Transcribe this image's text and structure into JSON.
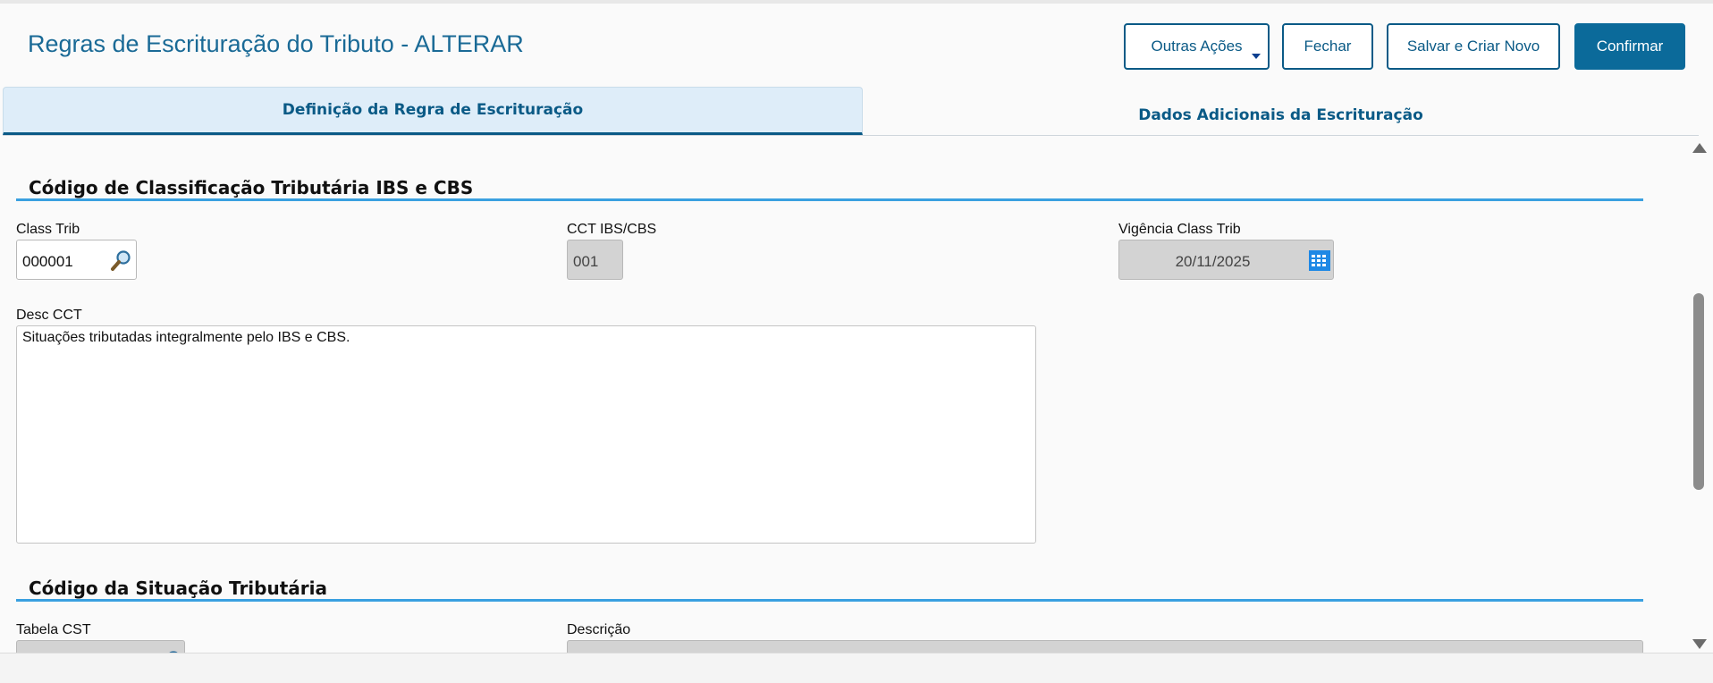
{
  "header": {
    "title": "Regras de Escrituração do Tributo - ALTERAR",
    "buttons": {
      "outras_acoes": "Outras Ações",
      "fechar": "Fechar",
      "salvar_criar_novo": "Salvar e Criar Novo",
      "confirmar": "Confirmar"
    }
  },
  "tabs": [
    {
      "label": "Definição da Regra de Escrituração",
      "active": true
    },
    {
      "label": "Dados Adicionais da Escrituração",
      "active": false
    }
  ],
  "sections": {
    "class_trib": {
      "title": "Código de Classificação Tributária IBS e CBS",
      "class_trib_label": "Class Trib",
      "class_trib_value": "000001",
      "cct_label": "CCT IBS/CBS",
      "cct_value": "001",
      "vigencia_label": "Vigência Class Trib",
      "vigencia_value": "20/11/2025",
      "desc_label": "Desc CCT",
      "desc_value": "Situações tributadas integralmente pelo IBS e CBS."
    },
    "cst": {
      "title": "Código da Situação Tributária",
      "tabela_label": "Tabela CST",
      "descricao_label": "Descrição"
    }
  },
  "icons": {
    "lookup": "magnifier-icon",
    "calendar": "calendar-icon",
    "dropdown": "caret-down-icon"
  },
  "colors": {
    "title": "#1a6a96",
    "primary": "#0b6a9a",
    "section_line": "#3aa0e0",
    "active_tab_bg": "#deedf9",
    "disabled_field": "#d3d3d3"
  }
}
